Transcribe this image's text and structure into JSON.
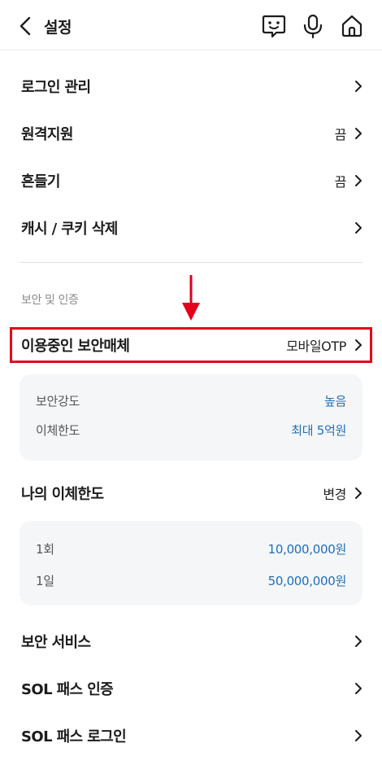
{
  "header": {
    "title": "설정",
    "icons": [
      "chevron-left-icon",
      "chat-bot-icon",
      "microphone-icon",
      "home-icon"
    ]
  },
  "settings": {
    "login_manage": {
      "label": "로그인 관리"
    },
    "remote_support": {
      "label": "원격지원",
      "value": "끔"
    },
    "shake": {
      "label": "흔들기",
      "value": "끔"
    },
    "cache_cookie": {
      "label": "캐시 / 쿠키 삭제"
    }
  },
  "security_section": {
    "title": "보안 및 인증",
    "media": {
      "label": "이용중인 보안매체",
      "value": "모바일OTP"
    },
    "media_card": {
      "strength_label": "보안강도",
      "strength_value": "높음",
      "limit_label": "이체한도",
      "limit_value": "최대 5억원"
    },
    "my_limit": {
      "label": "나의 이체한도",
      "value": "변경"
    },
    "limit_card": {
      "once_label": "1회",
      "once_value": "10,000,000원",
      "daily_label": "1일",
      "daily_value": "50,000,000원"
    },
    "security_service": {
      "label": "보안 서비스"
    },
    "sol_pass_auth": {
      "label": "SOL 패스 인증"
    },
    "sol_pass_login": {
      "label": "SOL 패스 로그인"
    }
  },
  "annotation": {
    "highlight_color": "#e3001b"
  },
  "colors": {
    "accent_value": "#1f6fb6",
    "card_bg": "#f5f6f8"
  }
}
